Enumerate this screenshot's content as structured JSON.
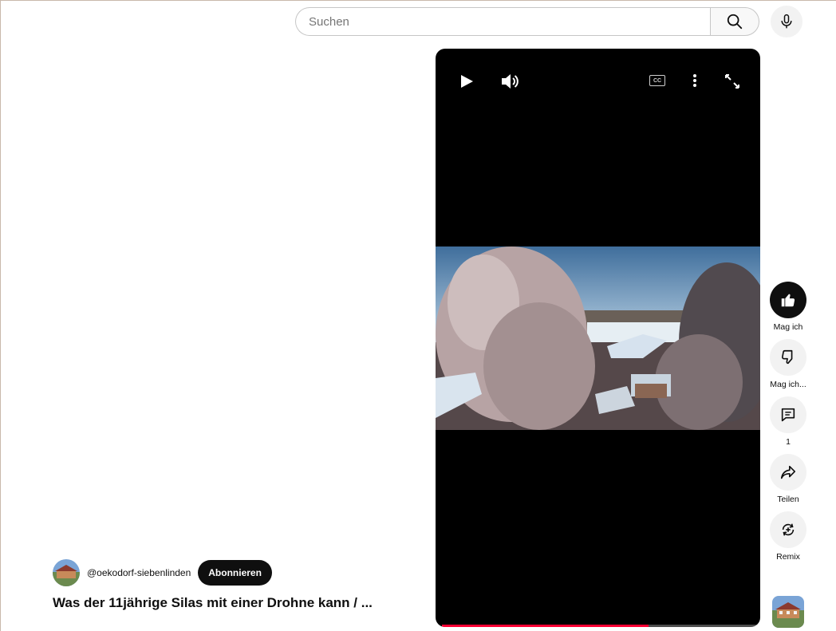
{
  "search": {
    "placeholder": "Suchen"
  },
  "actions": {
    "like_label": "Mag ich",
    "dislike_label": "Mag ich...",
    "comments_count": "1",
    "share_label": "Teilen",
    "remix_label": "Remix"
  },
  "channel": {
    "handle": "@oekodorf-siebenlinden",
    "subscribe_label": "Abonnieren"
  },
  "video": {
    "title": "Was der 11jährige Silas mit einer Drohne kann / ...",
    "cc_label": "CC",
    "progress_fraction": 0.65
  },
  "icons": {
    "search": "search-icon",
    "mic": "mic-icon",
    "play": "play-icon",
    "volume": "volume-icon",
    "captions": "captions-icon",
    "more": "more-vert-icon",
    "fullscreen": "fullscreen-icon",
    "like": "thumbs-up-icon",
    "dislike": "thumbs-down-icon",
    "comments": "comment-icon",
    "share": "share-icon",
    "remix": "remix-icon"
  },
  "colors": {
    "progress": "#ff0033",
    "subscribe_bg": "#0f0f0f",
    "player_bg": "#000000"
  }
}
